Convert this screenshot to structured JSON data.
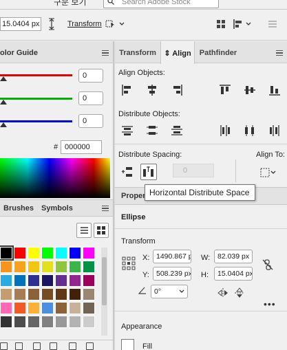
{
  "topbar": {
    "partial_label": "구분 보기",
    "search_placeholder": "Search Adobe Stock"
  },
  "control_bar": {
    "height_value": "15.0404 px",
    "transform_label": "Transform"
  },
  "left_panel": {
    "color_guide_tab": "olor Guide",
    "sliders": [
      {
        "channel": "R",
        "value": "0",
        "color": "#e00000"
      },
      {
        "channel": "G",
        "value": "0",
        "color": "#00b000"
      },
      {
        "channel": "B",
        "value": "0",
        "color": "#0000d0"
      }
    ],
    "hex_hash": "#",
    "hex_value": "000000",
    "tabs": [
      "Brushes",
      "Symbols"
    ],
    "swatches": [
      [
        "#000000",
        "#ff0000",
        "#ffff00",
        "#00ff00",
        "#00ffff",
        "#0000ff",
        "#ff00ff"
      ],
      [
        "#f7941d",
        "#f7a21b",
        "#f2c613",
        "#e3e11d",
        "#8dc63f",
        "#39b54a",
        "#009245"
      ],
      [
        "#29abe2",
        "#0071bc",
        "#2e3192",
        "#1b1464",
        "#662d91",
        "#93278f",
        "#9e005d"
      ],
      [
        "#c69c6d",
        "#a67c52",
        "#8c6239",
        "#754c24",
        "#603813",
        "#42210b",
        "#998675"
      ],
      [
        "#ff69b4",
        "#f15a24",
        "#fbb03b",
        "#4a90e2",
        "#8c6239",
        "#c7b299",
        "#736357"
      ],
      [
        "#333333",
        "#4d4d4d",
        "#666666",
        "#808080",
        "#999999",
        "#b3b3b3",
        "#cccccc"
      ]
    ]
  },
  "align_panel": {
    "tabs": [
      "Transform",
      "Align",
      "Pathfinder"
    ],
    "active_tab": "Align",
    "align_objects_label": "Align Objects:",
    "distribute_objects_label": "Distribute Objects:",
    "distribute_spacing_label": "Distribute Spacing:",
    "align_to_label": "Align To:",
    "spacing_value": "0",
    "tooltip": "Horizontal Distribute Space"
  },
  "properties_panel": {
    "tab_label": "Propert",
    "object_type": "Ellipse",
    "transform_label": "Transform",
    "x_label": "X:",
    "x_value": "1490.867 p",
    "y_label": "Y:",
    "y_value": "508.239 px",
    "w_label": "W:",
    "w_value": "82.039 px",
    "h_label": "H:",
    "h_value": "15.0404 px",
    "angle_value": "0°",
    "appearance_label": "Appearance",
    "fill_label": "Fill"
  },
  "colors": {
    "panel_bg": "#f0f0f0",
    "tab_bg": "#e3e3e3"
  }
}
